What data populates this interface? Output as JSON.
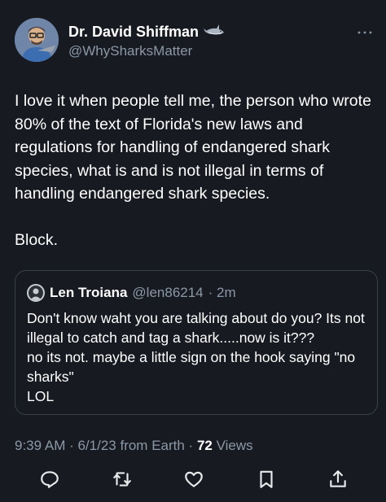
{
  "author": {
    "name": "Dr. David Shiffman",
    "handle": "@WhySharksMatter"
  },
  "tweet": {
    "text": "I love it when people tell me, the person who wrote 80% of the text of Florida's new laws and regulations for handling of endangered shark species, what is and is not illegal in terms of handling endangered shark species.\n\nBlock."
  },
  "quoted_tweet": {
    "name": "Len Troiana",
    "handle": "@len86214",
    "time": "· 2m",
    "text": "Don't know waht you are talking about do you? Its not illegal to catch and tag a shark.....now is it???\nno its not. maybe a little sign on the hook saying \"no sharks\"\nLOL"
  },
  "meta": {
    "timestamp": "9:39 AM · 6/1/23 from Earth ·",
    "views_count": "72",
    "views_label": "Views"
  },
  "colors": {
    "background": "#171a21",
    "text": "#ffffff",
    "muted": "#8b98a5",
    "border": "#3a404a"
  },
  "icons": {
    "more": "more-horizontal-icon",
    "reply": "reply-icon",
    "retweet": "retweet-icon",
    "like": "heart-icon",
    "bookmark": "bookmark-icon",
    "share": "share-icon"
  }
}
